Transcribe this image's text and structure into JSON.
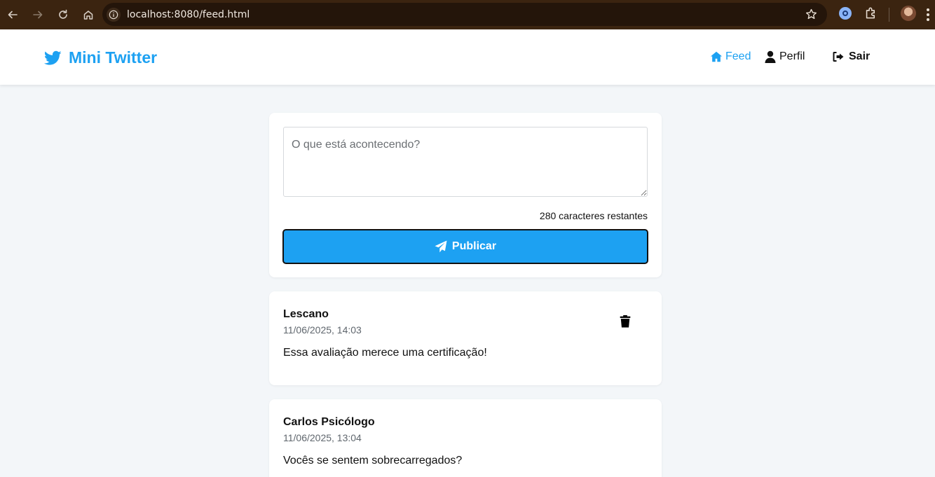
{
  "browser": {
    "url": "localhost:8080/feed.html"
  },
  "header": {
    "brand": "Mini Twitter",
    "nav": [
      {
        "label": "Feed",
        "icon": "home-icon",
        "active": true
      },
      {
        "label": "Perfil",
        "icon": "user-icon",
        "active": false
      },
      {
        "label": "Sair",
        "icon": "sign-out-icon",
        "active": false
      }
    ]
  },
  "composer": {
    "placeholder": "O que está acontecendo?",
    "value": "",
    "char_count": "280 caracteres restantes",
    "publish_label": "Publicar"
  },
  "posts": [
    {
      "author": "Lescano",
      "date": "11/06/2025, 14:03",
      "content": "Essa avaliação merece uma certificação!",
      "deletable": true
    },
    {
      "author": "Carlos Psicólogo",
      "date": "11/06/2025, 13:04",
      "content": "Vocês se sentem sobrecarregados?",
      "deletable": false
    }
  ],
  "colors": {
    "accent": "#1da1f2",
    "page_bg": "#f3f6f9",
    "browser_bar": "#3b2410"
  }
}
